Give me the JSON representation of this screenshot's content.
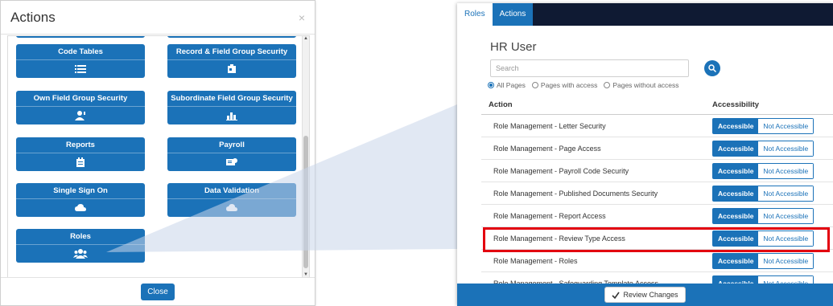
{
  "actions_modal": {
    "title": "Actions",
    "close_symbol": "×",
    "close_button": "Close",
    "tiles": [
      {
        "label": "Code Tables",
        "icon": "list-icon"
      },
      {
        "label": "Record & Field Group Security",
        "icon": "id-card-icon"
      },
      {
        "label": "Own Field Group Security",
        "icon": "user-key-icon"
      },
      {
        "label": "Subordinate Field Group Security",
        "icon": "org-chart-icon"
      },
      {
        "label": "Reports",
        "icon": "report-icon"
      },
      {
        "label": "Payroll",
        "icon": "payroll-icon"
      },
      {
        "label": "Single Sign On",
        "icon": "cloud-icon"
      },
      {
        "label": "Data Validation",
        "icon": "cloud-icon"
      },
      {
        "label": "Roles",
        "icon": "users-icon"
      }
    ]
  },
  "roles_panel": {
    "tabs": [
      {
        "label": "Roles",
        "active": false
      },
      {
        "label": "Actions",
        "active": true
      }
    ],
    "title": "HR User",
    "search_placeholder": "Search",
    "filters": [
      {
        "label": "All Pages",
        "selected": true
      },
      {
        "label": "Pages with access",
        "selected": false
      },
      {
        "label": "Pages without access",
        "selected": false
      }
    ],
    "columns": {
      "action": "Action",
      "accessibility": "Accessibility"
    },
    "toggle": {
      "on": "Accessible",
      "off": "Not Accessible"
    },
    "rows": [
      "Role Management - Letter Security",
      "Role Management - Page Access",
      "Role Management - Payroll Code Security",
      "Role Management - Published Documents Security",
      "Role Management - Report Access",
      "Role Management - Review Type Access",
      "Role Management - Roles",
      "Role Management - Safeguarding Template Access"
    ],
    "highlighted_row": "Role Management - Review Type Access",
    "review_button": "Review Changes"
  },
  "colors": {
    "accent": "#1b72b8",
    "tabbar": "#0f1a33",
    "highlight": "#e3000f"
  }
}
